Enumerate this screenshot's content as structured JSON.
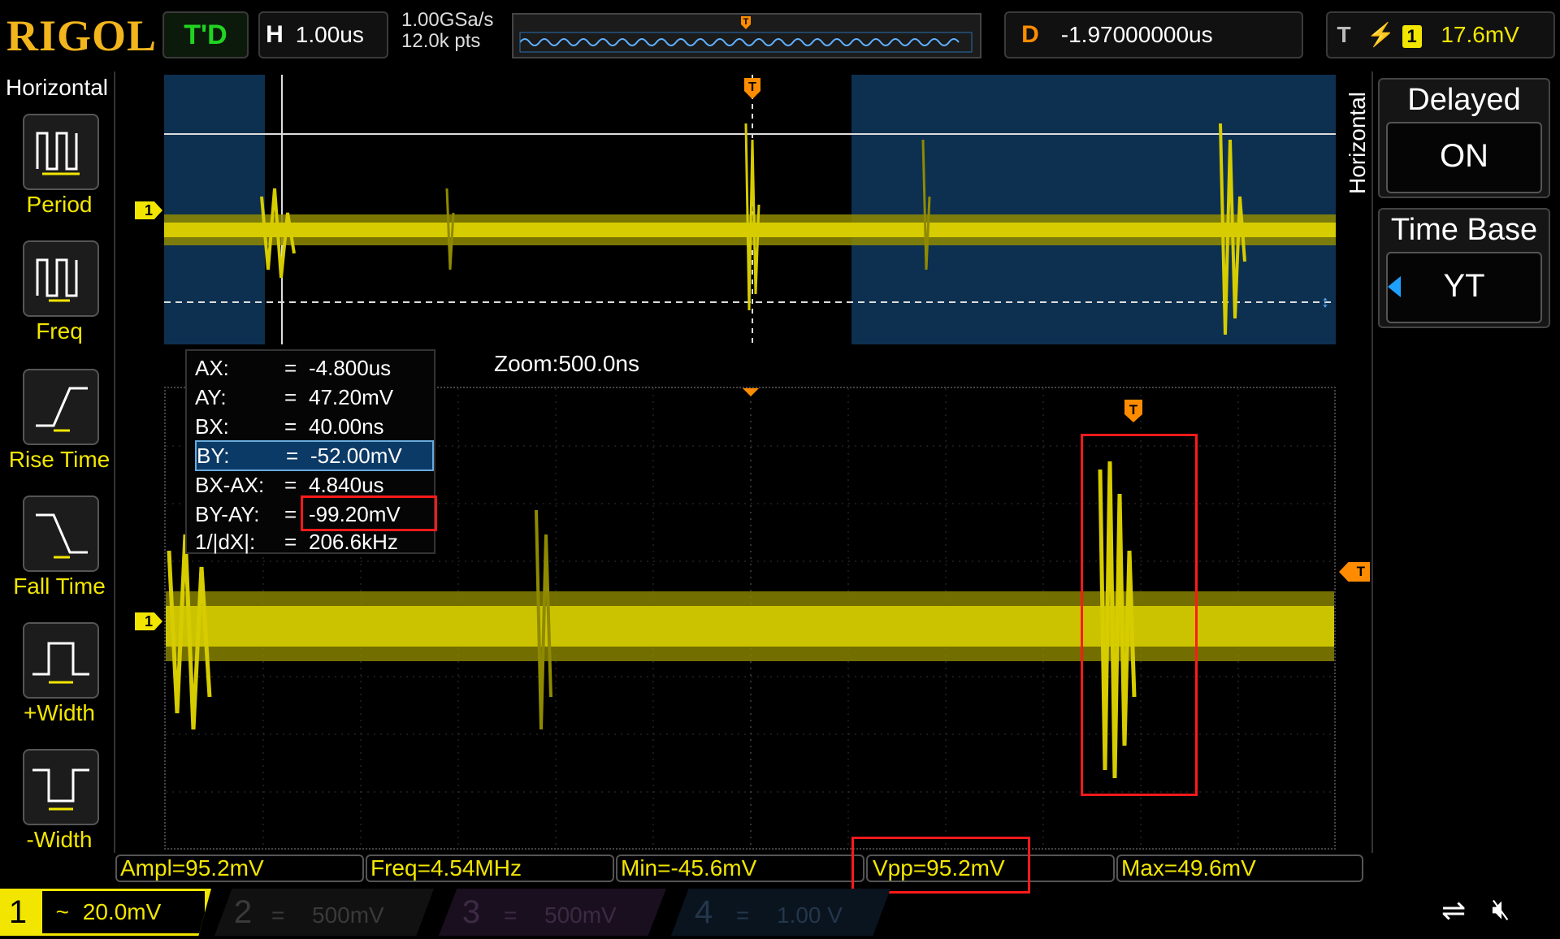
{
  "brand": "RIGOL",
  "top": {
    "run_state": "T'D",
    "horizontal_key": "H",
    "timebase": "1.00us",
    "sample_rate": "1.00GSa/s",
    "memory_depth": "12.0k pts",
    "delay_key": "D",
    "delay_value": "-1.97000000us",
    "trigger_key": "T",
    "trigger_channel": "1",
    "trigger_level": "17.6mV"
  },
  "left_menu": {
    "title": "Horizontal",
    "items": [
      {
        "label": "Period",
        "icon": "period-icon"
      },
      {
        "label": "Freq",
        "icon": "freq-icon"
      },
      {
        "label": "Rise Time",
        "icon": "rise-time-icon"
      },
      {
        "label": "Fall Time",
        "icon": "fall-time-icon"
      },
      {
        "label": "+Width",
        "icon": "pos-width-icon"
      },
      {
        "label": "-Width",
        "icon": "neg-width-icon"
      }
    ]
  },
  "cursor_table": [
    {
      "name": "AX:",
      "eq": "=",
      "value": "-4.800us"
    },
    {
      "name": "AY:",
      "eq": "=",
      "value": "47.20mV"
    },
    {
      "name": "BX:",
      "eq": "=",
      "value": "40.00ns"
    },
    {
      "name": "BY:",
      "eq": "=",
      "value": "-52.00mV"
    },
    {
      "name": "BX-AX:",
      "eq": "=",
      "value": "4.840us"
    },
    {
      "name": "BY-AY:",
      "eq": "=",
      "value": "-99.20mV"
    },
    {
      "name": "1/|dX|:",
      "eq": "=",
      "value": "206.6kHz"
    }
  ],
  "zoom_label": "Zoom:500.0ns",
  "channel_marker": "1",
  "trigger_marker": "T",
  "right_menu": {
    "vertical_label": "Horizontal",
    "delayed_title": "Delayed",
    "delayed_value": "ON",
    "timebase_title": "Time Base",
    "timebase_value": "YT"
  },
  "measurements": [
    "Ampl=95.2mV",
    "Freq=4.54MHz",
    "Min=-45.6mV",
    "Vpp=95.2mV",
    "Max=49.6mV"
  ],
  "channels": [
    {
      "num": "1",
      "coupling": "~",
      "scale": "20.0mV"
    },
    {
      "num": "2",
      "coupling": "=",
      "scale": "500mV"
    },
    {
      "num": "3",
      "coupling": "=",
      "scale": "500mV"
    },
    {
      "num": "4",
      "coupling": "=",
      "scale": "1.00 V"
    }
  ],
  "colors": {
    "ch1": "#f2e600",
    "trigger": "#ff8c00",
    "highlight": "#ff1a1a",
    "delayed_window": "#0d3050"
  }
}
